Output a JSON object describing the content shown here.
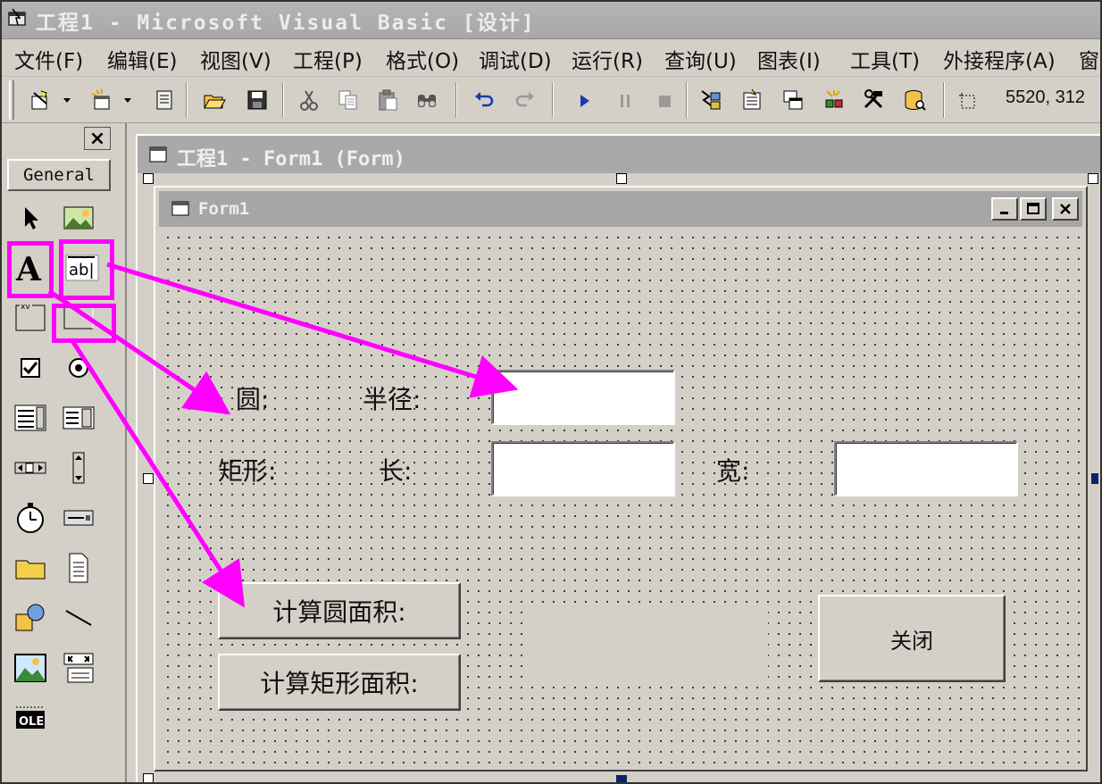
{
  "window": {
    "title": "工程1 - Microsoft Visual Basic [设计]"
  },
  "menu": {
    "items": [
      "文件(F)",
      "编辑(E)",
      "视图(V)",
      "工程(P)",
      "格式(O)",
      "调试(D)",
      "运行(R)",
      "查询(U)",
      "图表(I)",
      "工具(T)",
      "外接程序(A)",
      "窗"
    ]
  },
  "toolbar": {
    "coords": "5520, 312"
  },
  "toolbox": {
    "close": "×",
    "tab_label": "General"
  },
  "project_window": {
    "title": "工程1 - Form1 (Form)"
  },
  "form": {
    "title": "Form1",
    "labels": {
      "circle": "圆:",
      "radius": "半径:",
      "rectangle": "矩形:",
      "length": "长:",
      "width": "宽:"
    },
    "buttons": {
      "calc_circle": "计算圆面积:",
      "calc_rect": "计算矩形面积:",
      "close": "关闭"
    }
  },
  "colors": {
    "highlight": "#ff00ff",
    "window_bg": "#d4d0c8",
    "titlebar_inactive": "#a9a9a9"
  }
}
